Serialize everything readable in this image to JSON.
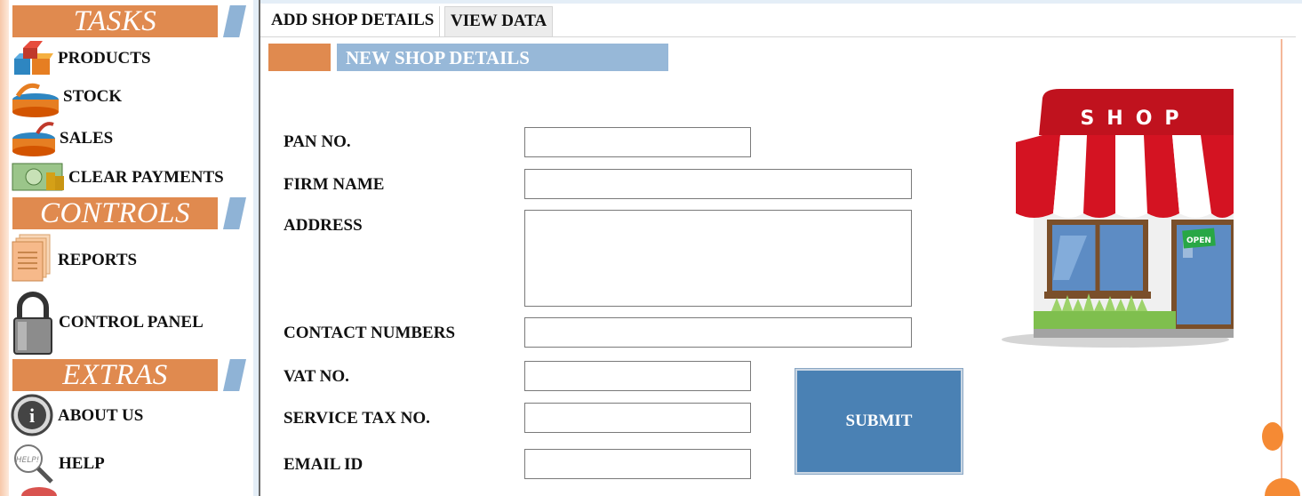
{
  "sidebar": {
    "sections": {
      "tasks": "TASKS",
      "controls": "CONTROLS",
      "extras": "EXTRAS"
    },
    "items": {
      "products": "PRODUCTS",
      "stock": "STOCK",
      "sales": "SALES",
      "clear_payments": "CLEAR PAYMENTS",
      "reports": "REPORTS",
      "control_panel": "CONTROL PANEL",
      "about_us": "ABOUT US",
      "help": "HELP"
    },
    "icons": {
      "products": "products-icon",
      "stock": "stock-icon",
      "sales": "sales-icon",
      "clear_payments": "money-icon",
      "reports": "documents-icon",
      "control_panel": "padlock-icon",
      "about_us": "info-icon",
      "help": "help-magnifier-icon",
      "help_text": "HELP!"
    }
  },
  "tabs": {
    "add_shop": "ADD SHOP DETAILS",
    "view_data": "VIEW DATA"
  },
  "form": {
    "title": "NEW SHOP DETAILS",
    "labels": {
      "pan_no": "PAN NO.",
      "firm_name": "FIRM NAME",
      "address": "ADDRESS",
      "contact_numbers": "CONTACT NUMBERS",
      "vat_no": "VAT NO.",
      "service_tax_no": "SERVICE TAX NO.",
      "email_id": "EMAIL ID"
    },
    "values": {
      "pan_no": "",
      "firm_name": "",
      "address": "",
      "contact_numbers": "",
      "vat_no": "",
      "service_tax_no": "",
      "email_id": ""
    },
    "submit_label": "SUBMIT"
  },
  "shop_image": {
    "sign_text": "SHOP",
    "open_text": "OPEN"
  },
  "colors": {
    "accent_orange": "#e08a4f",
    "accent_blue": "#97b8d8",
    "submit_blue": "#4a81b4"
  }
}
